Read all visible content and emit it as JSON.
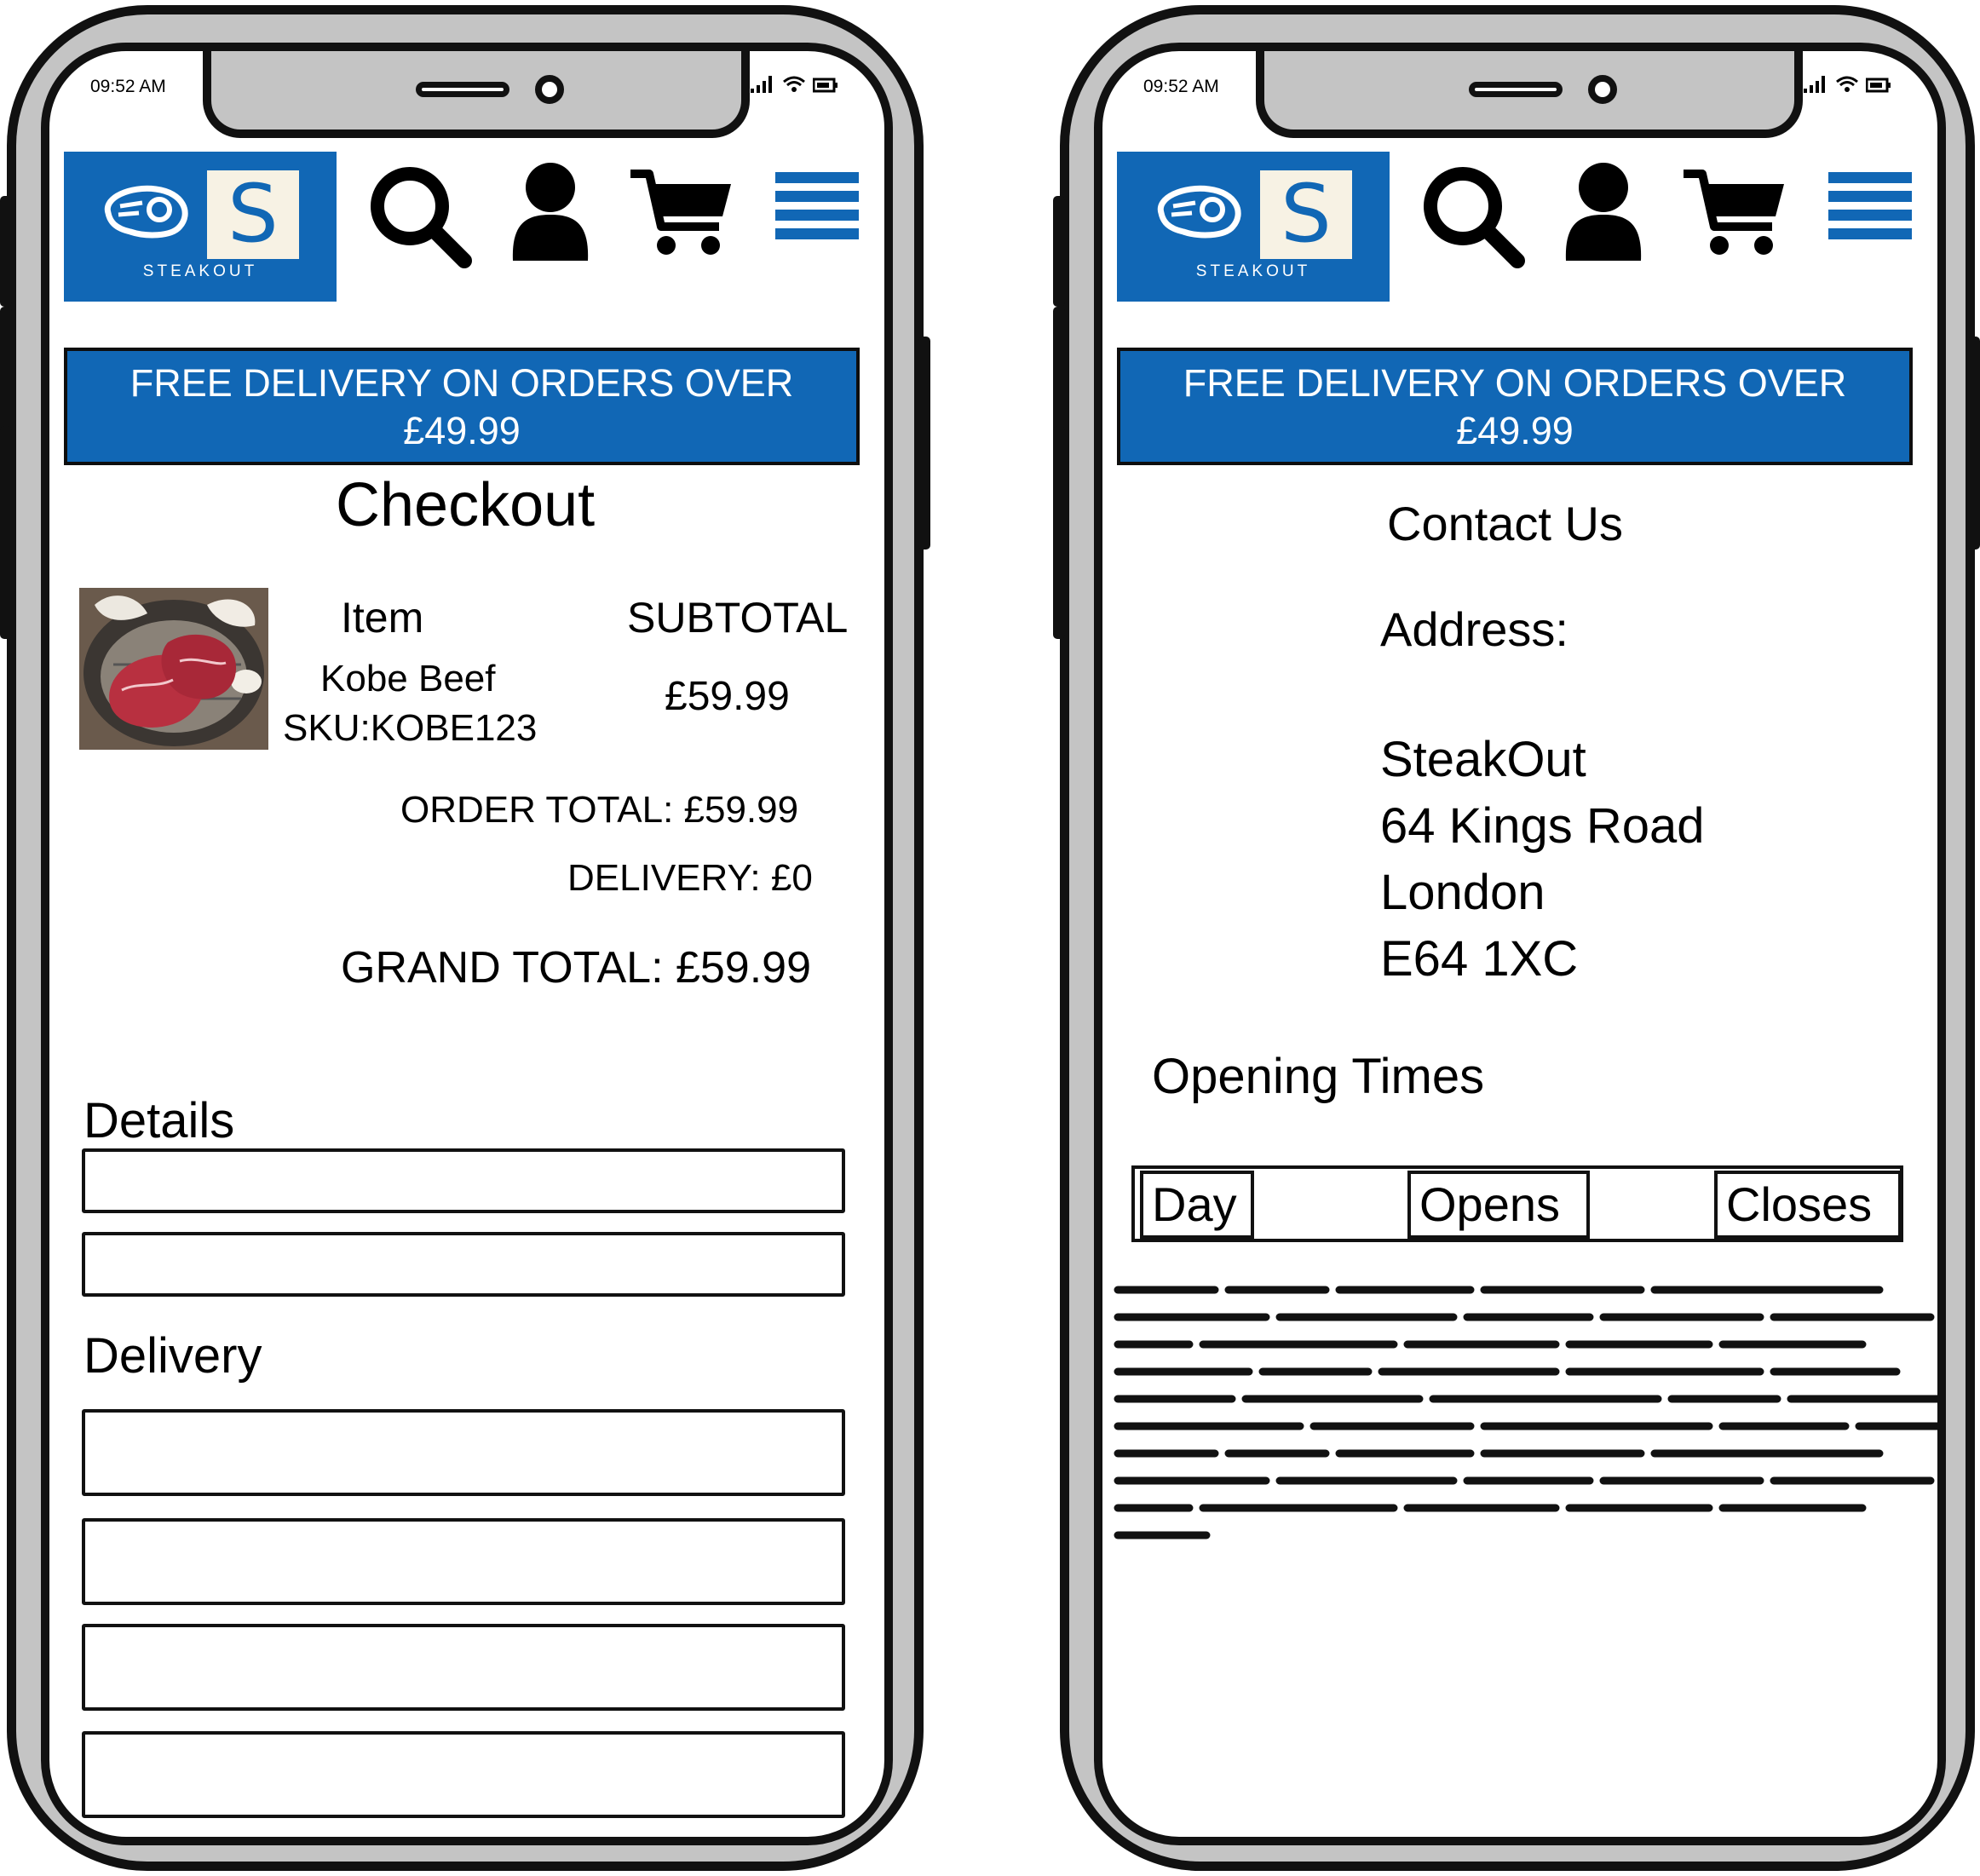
{
  "status_bar": {
    "time": "09:52 AM"
  },
  "header": {
    "logo_letter": "S",
    "logo_wordmark": "STEAKOUT",
    "icons": [
      "steak-icon",
      "search-icon",
      "user-icon",
      "cart-icon",
      "menu-icon"
    ]
  },
  "promo_banner": {
    "line1": "FREE DELIVERY ON ORDERS OVER",
    "line2": "£49.99"
  },
  "checkout": {
    "title": "Checkout",
    "col_item": "Item",
    "col_subtotal": "SUBTOTAL",
    "item_name": "Kobe Beef",
    "item_sku": "SKU:KOBE123",
    "item_subtotal": "£59.99",
    "order_total": "ORDER TOTAL: £59.99",
    "delivery": "DELIVERY: £0",
    "grand_total": "GRAND TOTAL: £59.99",
    "details_label": "Details",
    "delivery_label": "Delivery"
  },
  "contact": {
    "title": "Contact Us",
    "address_label": "Address:",
    "address_lines": [
      "SteakOut",
      "64 Kings Road",
      "London",
      "E64 1XC"
    ],
    "opening_times_label": "Opening Times",
    "table_headers": [
      "Day",
      "Opens",
      "Closes"
    ]
  },
  "colors": {
    "brand_blue": "#1167b5",
    "frame_grey": "#c4c4c4",
    "logo_cream": "#f7f2e4"
  }
}
